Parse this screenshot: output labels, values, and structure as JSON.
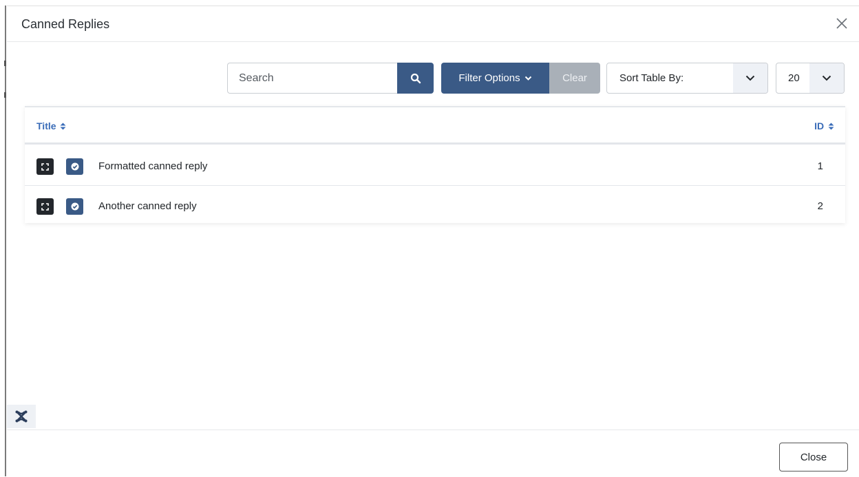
{
  "modal": {
    "title": "Canned Replies",
    "close_icon": "close-icon"
  },
  "toolbar": {
    "search_placeholder": "Search",
    "search_icon": "search-icon",
    "filter_label": "Filter Options",
    "clear_label": "Clear",
    "sort_label": "Sort Table By:",
    "limit_value": "20"
  },
  "table": {
    "columns": [
      {
        "label": "Title"
      },
      {
        "label": "ID"
      }
    ],
    "rows": [
      {
        "title": "Formatted canned reply",
        "id": "1"
      },
      {
        "title": "Another canned reply",
        "id": "2"
      }
    ]
  },
  "footer": {
    "close_label": "Close"
  },
  "colors": {
    "primary": "#3a5a86",
    "link": "#3a6cb8",
    "dark_button": "#23272c",
    "clear_button": "#a9b0b8"
  }
}
